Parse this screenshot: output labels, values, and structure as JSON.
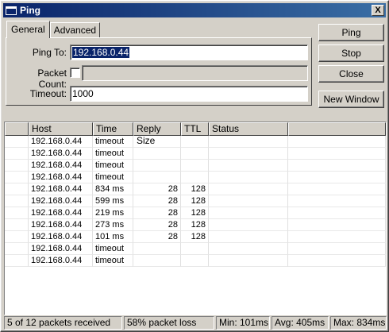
{
  "window": {
    "title": "Ping",
    "close_glyph": "X"
  },
  "tabs": [
    {
      "label": "General"
    },
    {
      "label": "Advanced"
    }
  ],
  "form": {
    "ping_to_label": "Ping To:",
    "ping_to_value": "192.168.0.44",
    "packet_count_label": "Packet Count:",
    "packet_count_value": "",
    "timeout_label": "Timeout:",
    "timeout_value": "1000"
  },
  "buttons": {
    "ping": "Ping",
    "stop": "Stop",
    "close": "Close",
    "new_window": "New Window"
  },
  "table": {
    "columns": [
      "",
      "Host",
      "Time",
      "Reply Size",
      "TTL",
      "Status"
    ],
    "rows": [
      {
        "host": "192.168.0.44",
        "time": "timeout",
        "size": "",
        "ttl": "",
        "status": ""
      },
      {
        "host": "192.168.0.44",
        "time": "timeout",
        "size": "",
        "ttl": "",
        "status": ""
      },
      {
        "host": "192.168.0.44",
        "time": "timeout",
        "size": "",
        "ttl": "",
        "status": ""
      },
      {
        "host": "192.168.0.44",
        "time": "timeout",
        "size": "",
        "ttl": "",
        "status": ""
      },
      {
        "host": "192.168.0.44",
        "time": "834 ms",
        "size": "28",
        "ttl": "128",
        "status": ""
      },
      {
        "host": "192.168.0.44",
        "time": "599 ms",
        "size": "28",
        "ttl": "128",
        "status": ""
      },
      {
        "host": "192.168.0.44",
        "time": "219 ms",
        "size": "28",
        "ttl": "128",
        "status": ""
      },
      {
        "host": "192.168.0.44",
        "time": "273 ms",
        "size": "28",
        "ttl": "128",
        "status": ""
      },
      {
        "host": "192.168.0.44",
        "time": "101 ms",
        "size": "28",
        "ttl": "128",
        "status": ""
      },
      {
        "host": "192.168.0.44",
        "time": "timeout",
        "size": "",
        "ttl": "",
        "status": ""
      },
      {
        "host": "192.168.0.44",
        "time": "timeout",
        "size": "",
        "ttl": "",
        "status": ""
      }
    ]
  },
  "status": {
    "received": "5 of 12 packets received",
    "loss": "58% packet loss",
    "min": "Min: 101ms",
    "avg": "Avg: 405ms",
    "max": "Max: 834ms"
  },
  "colors": {
    "titlebar_start": "#0a246a",
    "titlebar_end": "#3a6ea5",
    "face": "#d4d0c8",
    "selection": "#0a246a"
  }
}
